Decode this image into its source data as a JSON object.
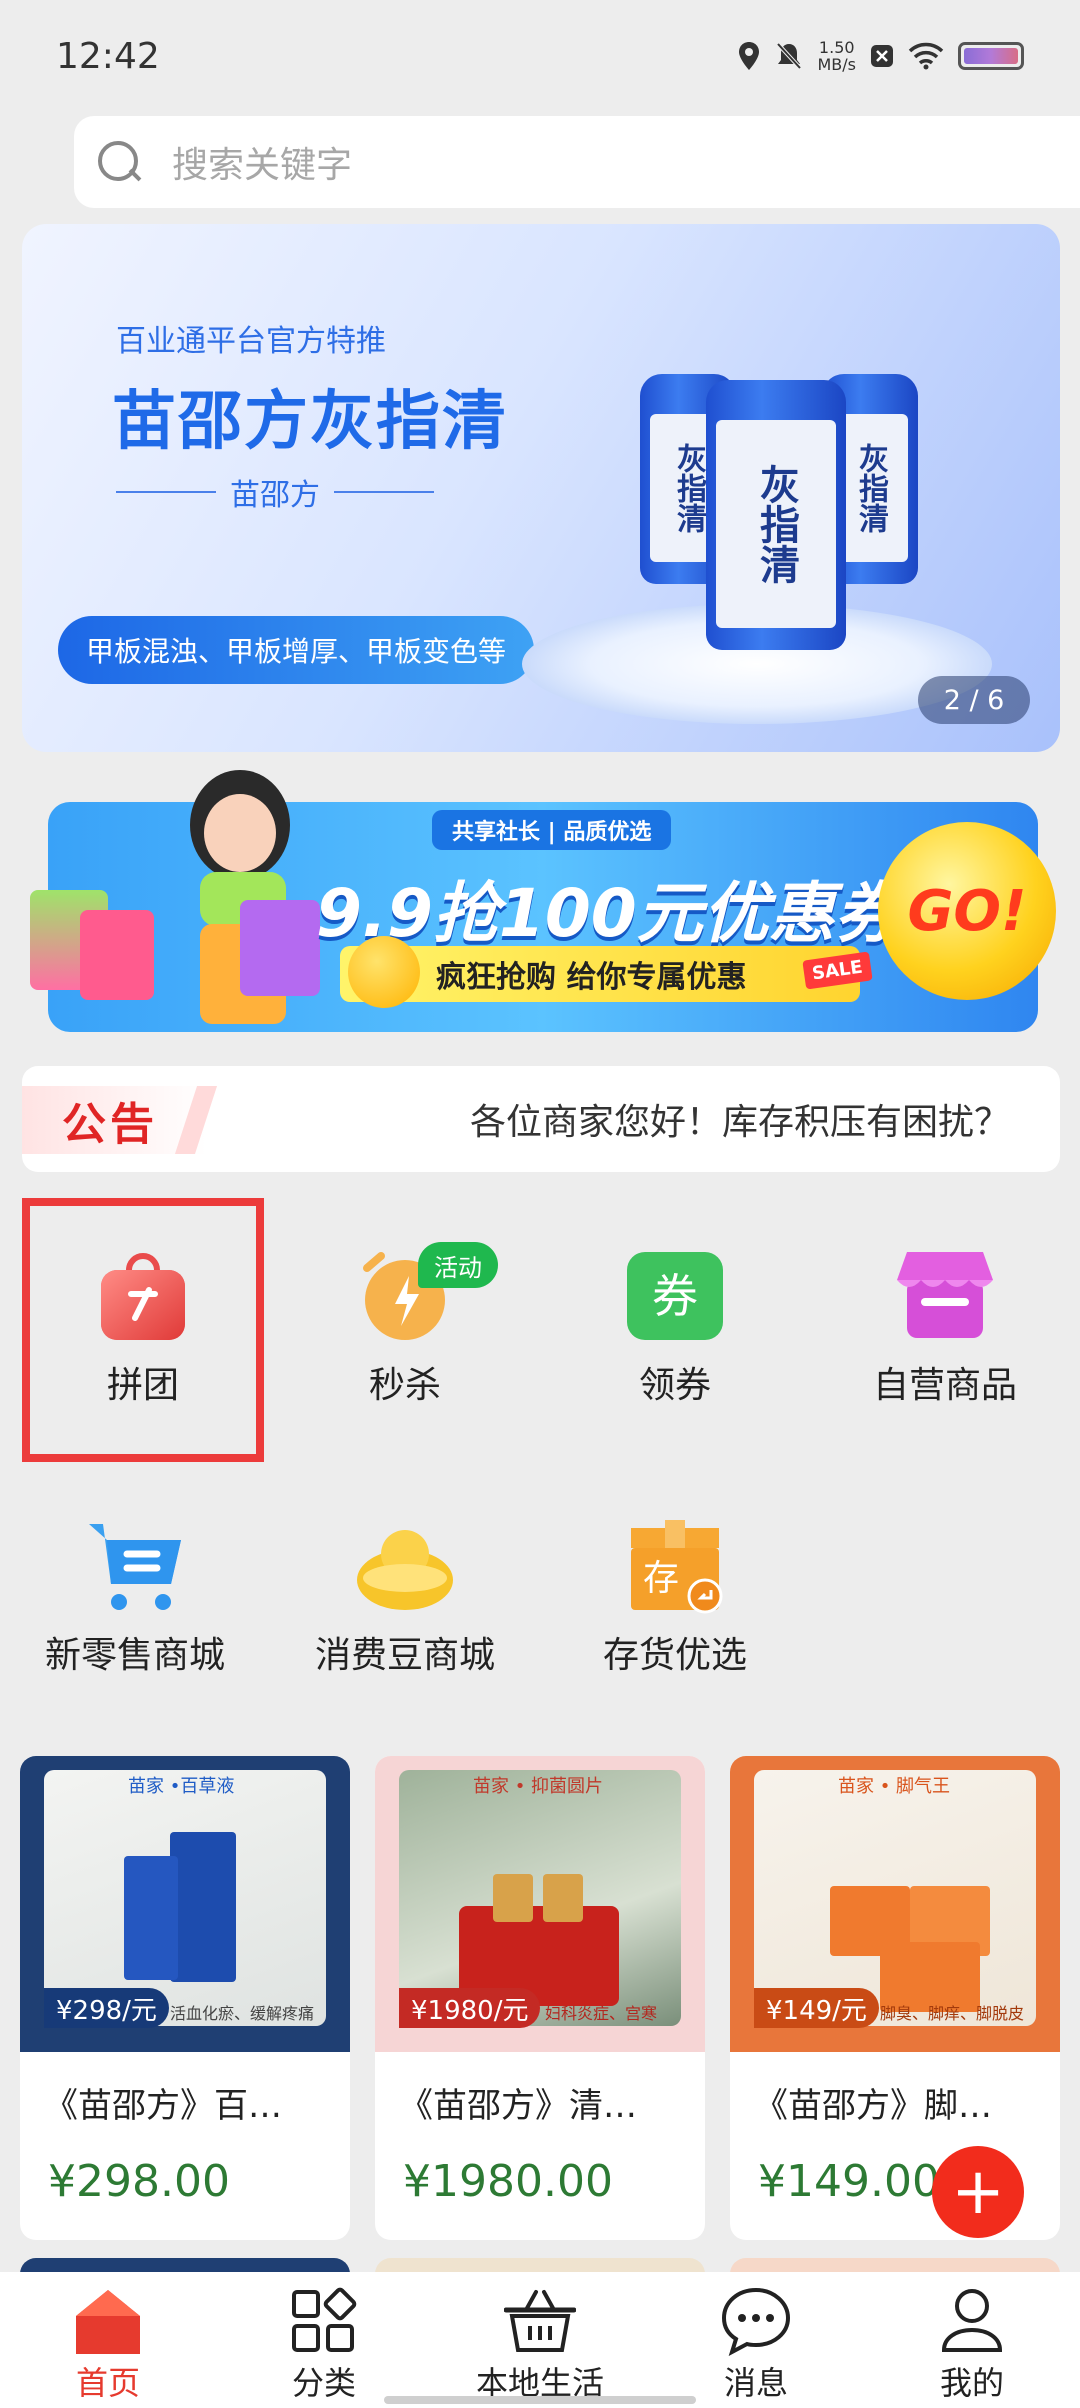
{
  "status_bar": {
    "time": "12:42",
    "net_speed_value": "1.50",
    "net_speed_unit": "MB/s"
  },
  "search": {
    "placeholder": "搜索关键字"
  },
  "hero_banner": {
    "subtitle": "百业通平台官方特推",
    "title": "苗邵方灰指清",
    "brand": "苗邵方",
    "pill": "甲板混浊、甲板增厚、甲板变色等",
    "jar_label": "灰指清",
    "pager": "2 / 6"
  },
  "coupon_banner": {
    "tag": "共享社长 | 品质优选",
    "headline": "9.9抢100元优惠券",
    "strip": "疯狂抢购 给你专属优惠",
    "sale": "SALE",
    "go": "GO!"
  },
  "notice": {
    "badge": "公告",
    "text": "各位商家您好！库存积压有困扰？"
  },
  "menu": [
    {
      "label": "拼团",
      "icon": "shopping-bag-icon"
    },
    {
      "label": "秒杀",
      "icon": "alarm-clock-icon",
      "badge": "活动"
    },
    {
      "label": "领券",
      "icon": "coupon-icon",
      "glyph": "券"
    },
    {
      "label": "自营商品",
      "icon": "store-icon"
    },
    {
      "label": "新零售商城",
      "icon": "cart-icon"
    },
    {
      "label": "消费豆商城",
      "icon": "gold-ingot-icon"
    },
    {
      "label": "存货优选",
      "icon": "storage-box-icon",
      "glyph": "存"
    }
  ],
  "products": [
    {
      "chip": "苗家 •百草液",
      "price_tag": "¥298/元",
      "benefit": "活血化瘀、缓解疼痛",
      "name": "《苗邵方》百…",
      "price": "¥298.00"
    },
    {
      "chip": "苗家 • 抑菌圆片",
      "price_tag": "¥1980/元",
      "benefit": "妇科炎症、宫寒",
      "name": "《苗邵方》清…",
      "price": "¥1980.00"
    },
    {
      "chip": "苗家 • 脚气王",
      "price_tag": "¥149/元",
      "benefit": "脚臭、脚痒、脚脱皮",
      "name": "《苗邵方》脚…",
      "price": "¥149.00"
    }
  ],
  "fab": "+",
  "bottom_nav": [
    {
      "label": "首页",
      "icon": "home-icon",
      "active": true
    },
    {
      "label": "分类",
      "icon": "category-grid-icon"
    },
    {
      "label": "本地生活",
      "icon": "basket-icon"
    },
    {
      "label": "消息",
      "icon": "chat-bubble-icon"
    },
    {
      "label": "我的",
      "icon": "user-icon"
    }
  ],
  "colors": {
    "accent_red": "#e63a2e",
    "price_green": "#2d7a34",
    "hero_blue": "#1f6ae8",
    "highlight_red": "#ec3b3b"
  }
}
